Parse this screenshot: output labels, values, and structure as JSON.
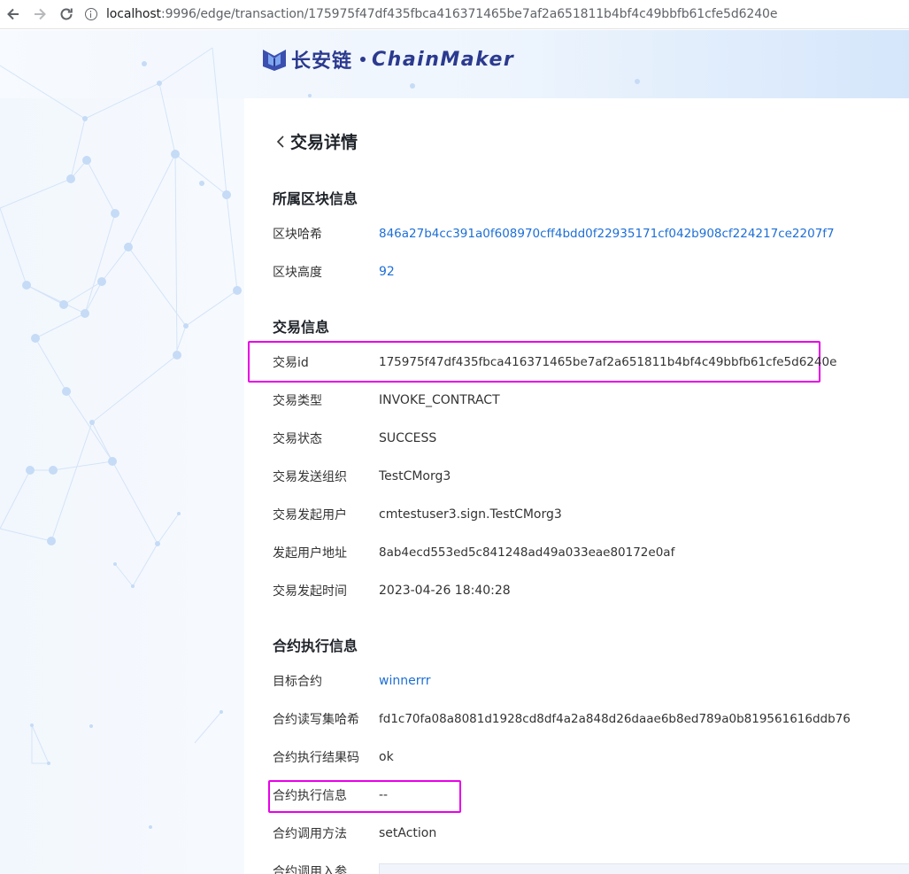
{
  "browser": {
    "url_host": "localhost",
    "url_rest": ":9996/edge/transaction/175975f47df435fbca416371465be7af2a651811b4bf4c49bbfb61cfe5d6240e"
  },
  "brand": {
    "cn": "长安链",
    "en": "ChainMaker"
  },
  "page_title": "交易详情",
  "block_section": {
    "title": "所属区块信息",
    "rows": [
      {
        "label": "区块哈希",
        "value": "846a27b4cc391a0f608970cff4bdd0f22935171cf042b908cf224217ce2207f7"
      },
      {
        "label": "区块高度",
        "value": "92"
      }
    ]
  },
  "tx_section": {
    "title": "交易信息",
    "rows": [
      {
        "label": "交易id",
        "value": "175975f47df435fbca416371465be7af2a651811b4bf4c49bbfb61cfe5d6240e"
      },
      {
        "label": "交易类型",
        "value": "INVOKE_CONTRACT"
      },
      {
        "label": "交易状态",
        "value": "SUCCESS"
      },
      {
        "label": "交易发送组织",
        "value": "TestCMorg3"
      },
      {
        "label": "交易发起用户",
        "value": "cmtestuser3.sign.TestCMorg3"
      },
      {
        "label": "发起用户地址",
        "value": "8ab4ecd553ed5c841248ad49a033eae80172e0af"
      },
      {
        "label": "交易发起时间",
        "value": "2023-04-26 18:40:28"
      }
    ]
  },
  "contract_section": {
    "title": "合约执行信息",
    "rows": [
      {
        "label": "目标合约",
        "value": "winnerrr"
      },
      {
        "label": "合约读写集哈希",
        "value": "fd1c70fa08a8081d1928cd8df4a2a848d26daae6b8ed789a0b819561616ddb76"
      },
      {
        "label": "合约执行结果码",
        "value": "ok"
      },
      {
        "label": "合约执行信息",
        "value": "--"
      },
      {
        "label": "合约调用方法",
        "value": "setAction"
      },
      {
        "label": "合约调用入参",
        "value": ""
      }
    ]
  },
  "colors": {
    "link": "#1d6fd6",
    "highlight": "#e800e8",
    "brand": "#2b3a8f"
  }
}
